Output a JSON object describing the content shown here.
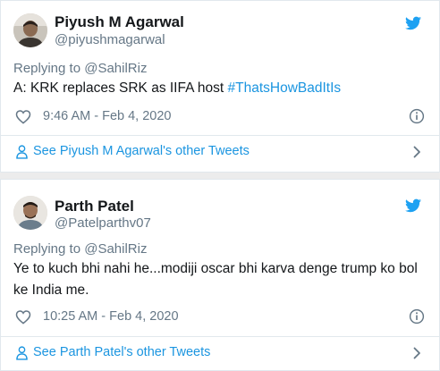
{
  "colors": {
    "link": "#1b95e0",
    "muted": "#657786",
    "text": "#14171a",
    "border": "#e1e8ed",
    "twitter_blue": "#1da1f2"
  },
  "tweets": [
    {
      "author_name": "Piyush M Agarwal",
      "author_handle": "@piyushmagarwal",
      "reply_prefix": "Replying to ",
      "reply_to": "@SahilRiz",
      "text": "A: KRK replaces SRK as IIFA host ",
      "hashtag": "#ThatsHowBadItIs",
      "timestamp": "9:46 AM - Feb 4, 2020",
      "see_more": "See Piyush M Agarwal's other Tweets",
      "icons": [
        "avatar",
        "twitter-bird-icon",
        "heart-icon",
        "info-icon",
        "person-icon",
        "chevron-right-icon"
      ]
    },
    {
      "author_name": "Parth Patel",
      "author_handle": "@Patelparthv07",
      "reply_prefix": "Replying to ",
      "reply_to": "@SahilRiz",
      "text": "Ye to kuch bhi nahi he...modiji oscar bhi karva denge trump ko bol ke India me.",
      "timestamp": "10:25 AM - Feb 4, 2020",
      "see_more": "See Parth Patel's other Tweets",
      "icons": [
        "avatar",
        "twitter-bird-icon",
        "heart-icon",
        "info-icon",
        "person-icon",
        "chevron-right-icon"
      ]
    }
  ]
}
